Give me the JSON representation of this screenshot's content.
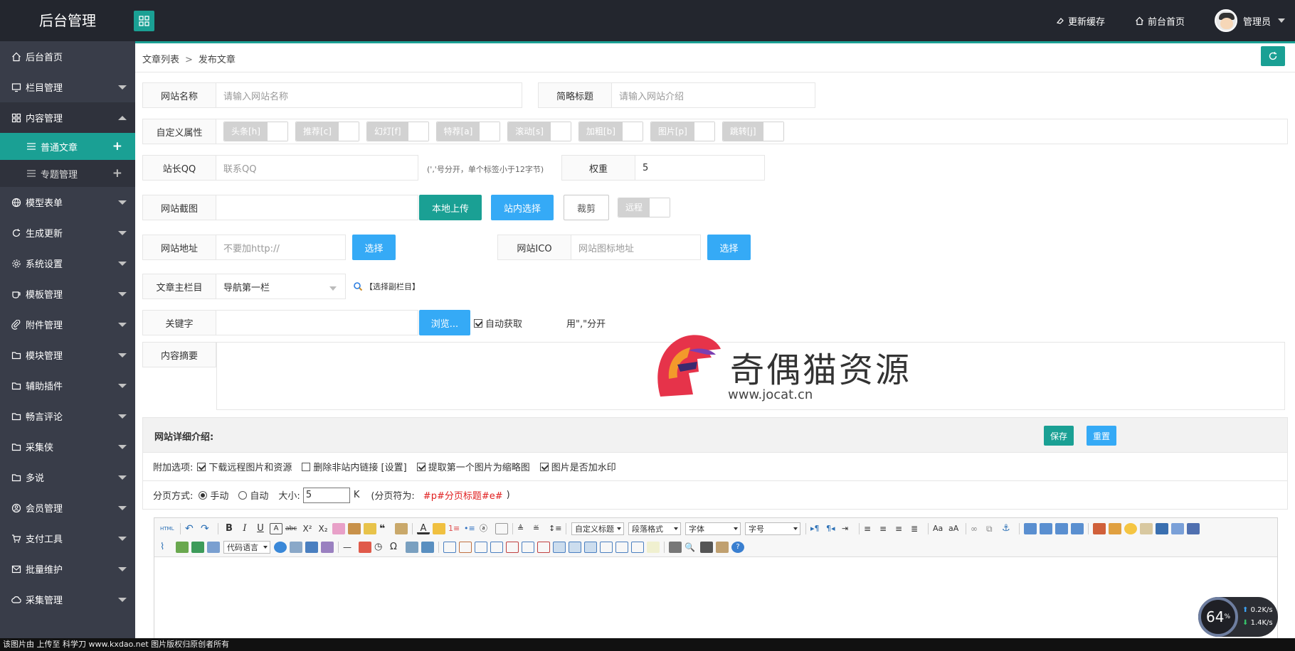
{
  "header": {
    "brand": "后台管理",
    "nav": [
      {
        "label": "更新缓存",
        "icon": "eraser-icon"
      },
      {
        "label": "前台首页",
        "icon": "home-icon"
      }
    ],
    "user": "管理员"
  },
  "sidebar": {
    "items": [
      {
        "label": "后台首页",
        "icon": "home-icon"
      },
      {
        "label": "栏目管理",
        "icon": "monitor-icon"
      },
      {
        "label": "内容管理",
        "icon": "grid-icon"
      },
      {
        "label": "模型表单",
        "icon": "globe-icon"
      },
      {
        "label": "生成更新",
        "icon": "refresh-icon"
      },
      {
        "label": "系统设置",
        "icon": "gear-icon"
      },
      {
        "label": "模板管理",
        "icon": "cup-icon"
      },
      {
        "label": "附件管理",
        "icon": "paperclip-icon"
      },
      {
        "label": "模块管理",
        "icon": "folder-icon"
      },
      {
        "label": "辅助插件",
        "icon": "folder-icon"
      },
      {
        "label": "畅言评论",
        "icon": "folder-icon"
      },
      {
        "label": "采集侠",
        "icon": "folder-icon"
      },
      {
        "label": "多说",
        "icon": "folder-icon"
      },
      {
        "label": "会员管理",
        "icon": "user-circle-icon"
      },
      {
        "label": "支付工具",
        "icon": "cart-icon"
      },
      {
        "label": "批量维护",
        "icon": "mail-icon"
      },
      {
        "label": "采集管理",
        "icon": "cloud-icon"
      }
    ],
    "sub": [
      {
        "label": "普通文章",
        "active": true
      },
      {
        "label": "专题管理",
        "active": false
      }
    ]
  },
  "breadcrumb": {
    "parent": "文章列表",
    "sep": ">",
    "current": "发布文章"
  },
  "form": {
    "site_name": {
      "label": "网站名称",
      "placeholder": "请输入网站名称"
    },
    "short_title": {
      "label": "简略标题",
      "placeholder": "请输入网站介绍"
    },
    "attributes": {
      "label": "自定义属性",
      "flags": [
        "头条[h]",
        "推荐[c]",
        "幻灯[f]",
        "特荐[a]",
        "滚动[s]",
        "加粗[b]",
        "图片[p]",
        "跳转[j]"
      ]
    },
    "qq": {
      "label": "站长QQ",
      "placeholder": "联系QQ",
      "hint": "(','号分开，单个标签小于12字节)"
    },
    "weight": {
      "label": "权重",
      "value": "5"
    },
    "screenshot": {
      "label": "网站截图",
      "upload": "本地上传",
      "choose": "站内选择",
      "crop": "裁剪",
      "remote": "远程"
    },
    "url": {
      "label": "网站地址",
      "placeholder": "不要加http://",
      "button": "选择"
    },
    "ico": {
      "label": "网站ICO",
      "placeholder": "网站图标地址",
      "button": "选择"
    },
    "column": {
      "label": "文章主栏目",
      "value": "导航第一栏",
      "sub_link": "【选择副栏目】"
    },
    "keywords": {
      "label": "关键字",
      "browse": "浏览...",
      "auto": "自动获取",
      "hint_tail": "用\",\"分开"
    },
    "summary": {
      "label": "内容摘要"
    }
  },
  "detail": {
    "title": "网站详细介绍:",
    "save": "保存",
    "reset": "重置",
    "extra_label": "附加选项:",
    "extra_opts": [
      {
        "label": "下载远程图片和资源",
        "checked": true
      },
      {
        "label": "删除非站内链接 [设置]",
        "checked": false
      },
      {
        "label": "提取第一个图片为缩略图",
        "checked": true
      },
      {
        "label": "图片是否加水印",
        "checked": true
      }
    ],
    "paging_label": "分页方式:",
    "paging_manual": "手动",
    "paging_auto": "自动",
    "size_label": "大小:",
    "size_value": "5",
    "size_unit": "K",
    "paging_sym_label": "(分页符为:",
    "paging_sym": "#p#分页标题#e#",
    "paging_sym_close": ")"
  },
  "editor": {
    "selects": [
      "自定义标题",
      "段落格式",
      "字体",
      "字号"
    ],
    "code_lang": "代码语言"
  },
  "watermark": {
    "name": "奇偶猫资源",
    "url": "www.jocat.cn"
  },
  "footer": "该图片由  上传至 科学刀 www.kxdao.net 图片版权归原创者所有",
  "speed": {
    "percent": "64",
    "unit": "%",
    "up": "0.2K/s",
    "down": "1.4K/s"
  }
}
